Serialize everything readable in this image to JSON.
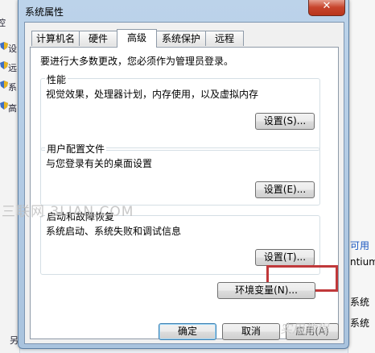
{
  "background": {
    "left_items": [
      "设",
      "远",
      "系",
      "高"
    ],
    "left_top_glyph": "控",
    "left_bottom_glyph": "另",
    "right_texts": [
      {
        "text": "可用",
        "link": true
      },
      {
        "text": "ntium",
        "link": false
      },
      {
        "text": "系统",
        "link": false
      },
      {
        "text": "系统",
        "link": false
      }
    ]
  },
  "dialog": {
    "title": "系统属性",
    "close_glyph": "✕",
    "tabs": [
      {
        "label": "计算机名",
        "active": false
      },
      {
        "label": "硬件",
        "active": false
      },
      {
        "label": "高级",
        "active": true
      },
      {
        "label": "系统保护",
        "active": false
      },
      {
        "label": "远程",
        "active": false
      }
    ],
    "instruction": "要进行大多数更改，您必须作为管理员登录。",
    "performance": {
      "legend": "性能",
      "description": "视觉效果，处理器计划，内存使用，以及虚拟内存",
      "button": "设置(S)..."
    },
    "user_profiles": {
      "legend": "用户配置文件",
      "description": "与您登录有关的桌面设置",
      "button": "设置(E)..."
    },
    "startup_recovery": {
      "legend": "启动和故障恢复",
      "description": "系统启动、系统失败和调试信息",
      "button": "设置(T)..."
    },
    "env_button": "环境变量(N)...",
    "ok_button": "确定",
    "cancel_button": "取消",
    "apply_button": "应用(A)"
  },
  "watermarks": {
    "top": "三联网 3LIAN.COM",
    "bottom": "实用教程"
  },
  "accent": {
    "highlight_color": "#c0383a",
    "close_color": "#c7452d"
  }
}
